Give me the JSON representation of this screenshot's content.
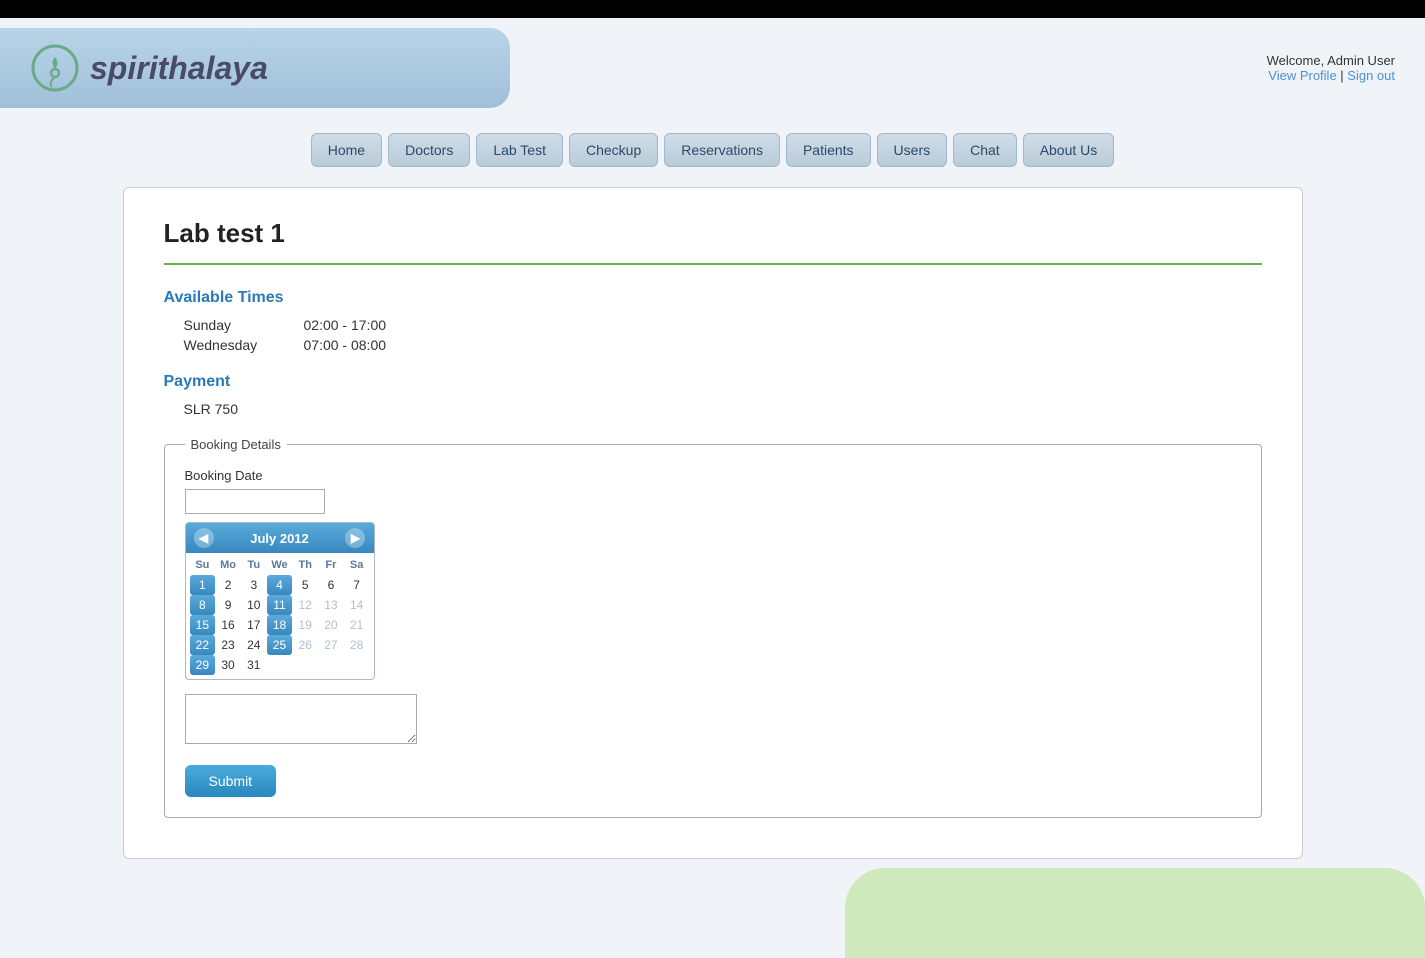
{
  "topbar": {},
  "header": {
    "logo_text": "spirithalaya",
    "user_greeting": "Welcome, Admin User",
    "view_profile_label": "View Profile",
    "sign_out_label": "Sign out"
  },
  "nav": {
    "items": [
      {
        "label": "Home",
        "id": "home"
      },
      {
        "label": "Doctors",
        "id": "doctors"
      },
      {
        "label": "Lab Test",
        "id": "labtest"
      },
      {
        "label": "Checkup",
        "id": "checkup"
      },
      {
        "label": "Reservations",
        "id": "reservations"
      },
      {
        "label": "Patients",
        "id": "patients"
      },
      {
        "label": "Users",
        "id": "users"
      },
      {
        "label": "Chat",
        "id": "chat"
      },
      {
        "label": "About Us",
        "id": "aboutus"
      }
    ]
  },
  "page": {
    "title": "Lab test 1",
    "available_times_heading": "Available Times",
    "schedule": [
      {
        "day": "Sunday",
        "time": "02:00 - 17:00"
      },
      {
        "day": "Wednesday",
        "time": "07:00 - 08:00"
      }
    ],
    "payment_heading": "Payment",
    "payment_amount": "SLR 750",
    "booking_details_legend": "Booking Details",
    "booking_date_label": "Booking Date",
    "booking_date_value": "",
    "calendar": {
      "month_year": "July 2012",
      "prev_label": "◀",
      "next_label": "▶",
      "day_headers": [
        "Su",
        "Mo",
        "Tu",
        "We",
        "Th",
        "Fr",
        "Sa"
      ],
      "weeks": [
        [
          {
            "day": "1",
            "type": "highlight"
          },
          {
            "day": "2",
            "type": "normal"
          },
          {
            "day": "3",
            "type": "normal"
          },
          {
            "day": "4",
            "type": "highlight"
          },
          {
            "day": "5",
            "type": "normal"
          },
          {
            "day": "6",
            "type": "normal"
          },
          {
            "day": "7",
            "type": "normal"
          }
        ],
        [
          {
            "day": "8",
            "type": "highlight"
          },
          {
            "day": "9",
            "type": "normal"
          },
          {
            "day": "10",
            "type": "normal"
          },
          {
            "day": "11",
            "type": "highlight"
          },
          {
            "day": "12",
            "type": "muted"
          },
          {
            "day": "13",
            "type": "muted"
          },
          {
            "day": "14",
            "type": "muted"
          }
        ],
        [
          {
            "day": "15",
            "type": "highlight"
          },
          {
            "day": "16",
            "type": "normal"
          },
          {
            "day": "17",
            "type": "normal"
          },
          {
            "day": "18",
            "type": "highlight"
          },
          {
            "day": "19",
            "type": "muted"
          },
          {
            "day": "20",
            "type": "muted"
          },
          {
            "day": "21",
            "type": "muted"
          }
        ],
        [
          {
            "day": "22",
            "type": "highlight"
          },
          {
            "day": "23",
            "type": "normal"
          },
          {
            "day": "24",
            "type": "normal"
          },
          {
            "day": "25",
            "type": "highlight"
          },
          {
            "day": "26",
            "type": "muted"
          },
          {
            "day": "27",
            "type": "muted"
          },
          {
            "day": "28",
            "type": "muted"
          }
        ],
        [
          {
            "day": "29",
            "type": "highlight"
          },
          {
            "day": "30",
            "type": "normal"
          },
          {
            "day": "31",
            "type": "normal"
          },
          {
            "day": "",
            "type": "empty"
          },
          {
            "day": "",
            "type": "empty"
          },
          {
            "day": "",
            "type": "empty"
          },
          {
            "day": "",
            "type": "empty"
          }
        ]
      ]
    },
    "submit_label": "Submit"
  }
}
